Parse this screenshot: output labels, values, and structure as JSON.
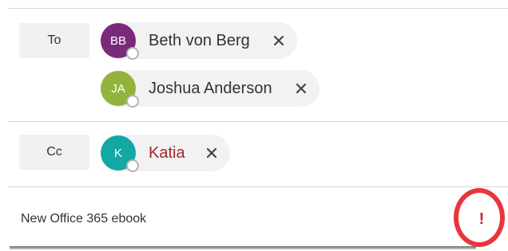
{
  "colors": {
    "accent": "#c4262e",
    "external_name": "#a4262c",
    "avatar_bb": "#7a2a7a",
    "avatar_ja": "#92b43d",
    "avatar_k": "#13a7a6",
    "highlight_ring": "#e8363d"
  },
  "to": {
    "button_label": "To",
    "recipients": [
      {
        "initials": "BB",
        "name": "Beth von Berg",
        "remove_icon": "close-icon"
      },
      {
        "initials": "JA",
        "name": "Joshua Anderson",
        "remove_icon": "close-icon"
      }
    ]
  },
  "cc": {
    "button_label": "Cc",
    "recipients": [
      {
        "initials": "K",
        "name": "Katia",
        "remove_icon": "close-icon"
      }
    ]
  },
  "subject": {
    "value": "New Office 365 ebook"
  },
  "importance": {
    "label": "!",
    "icon": "high-importance-icon"
  }
}
